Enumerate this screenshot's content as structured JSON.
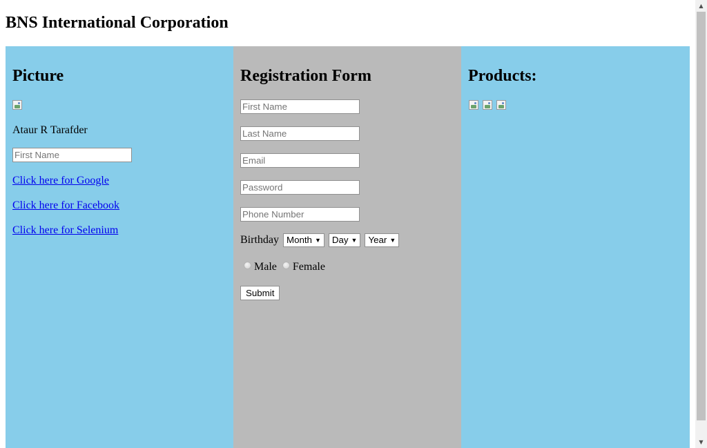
{
  "header": {
    "title": "BNS International Corporation"
  },
  "left_column": {
    "heading": "Picture",
    "picture_icon": "broken-image-icon",
    "name_text": "Ataur R Tarafder",
    "first_name_placeholder": "First Name",
    "links": [
      "Click here for Google",
      "Click here for Facebook",
      "Click here for Selenium"
    ]
  },
  "registration": {
    "heading": "Registration Form",
    "placeholders": {
      "first_name": "First Name",
      "last_name": "Last Name",
      "email": "Email",
      "password": "Password",
      "phone": "Phone Number"
    },
    "birthday_label": "Birthday",
    "month_selected": "Month",
    "day_selected": "Day",
    "year_selected": "Year",
    "gender_male": "Male",
    "gender_female": "Female",
    "submit_label": "Submit"
  },
  "products": {
    "heading": "Products:",
    "image_icons": [
      "broken-image-icon",
      "broken-image-icon",
      "broken-image-icon"
    ]
  },
  "colors": {
    "side_panel_bg": "#87cdea",
    "middle_panel_bg": "#bababa",
    "link": "#0000ee"
  }
}
